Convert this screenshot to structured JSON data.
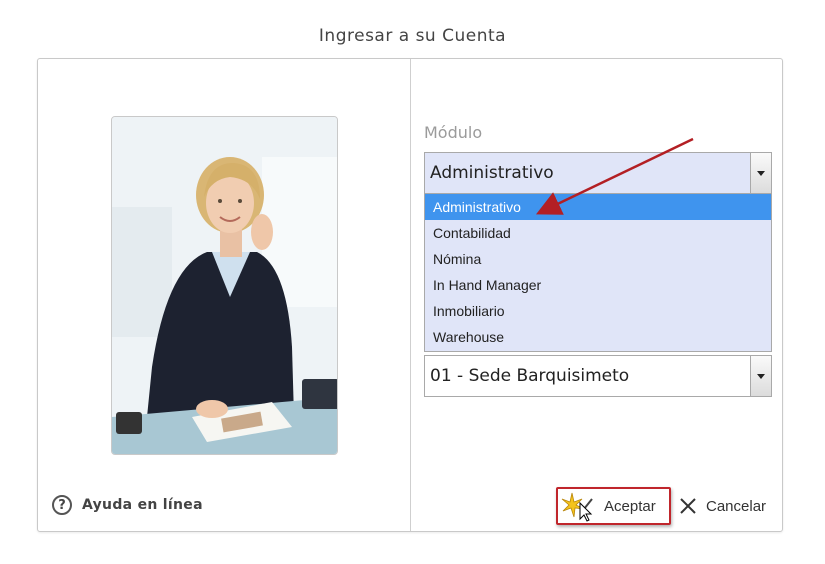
{
  "dialog": {
    "title": "Ingresar a su Cuenta"
  },
  "help": {
    "label": "Ayuda en línea",
    "icon": "question-icon"
  },
  "modulo": {
    "label": "Módulo",
    "selected": "Administrativo",
    "options": [
      "Administrativo",
      "Contabilidad",
      "Nómina",
      "In Hand Manager",
      "Inmobiliario",
      "Warehouse"
    ],
    "highlighted_index": 0
  },
  "sede": {
    "selected": "01 - Sede Barquisimeto"
  },
  "buttons": {
    "accept_label": "Aceptar",
    "cancel_label": "Cancelar"
  },
  "colors": {
    "select_bg": "#e0e5f8",
    "highlight": "#3f94ee",
    "annotation_red": "#c0262c"
  }
}
